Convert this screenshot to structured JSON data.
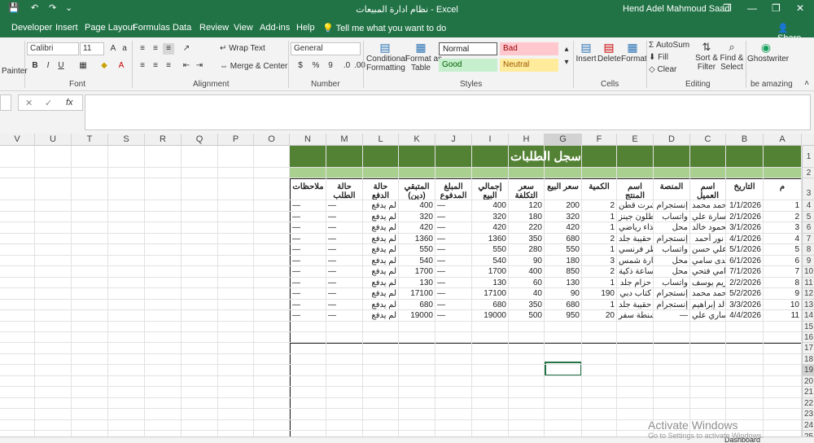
{
  "titlebar": {
    "title": "نظام ادارة المبيعات  -  Excel",
    "user": "Hend  Adel Mahmoud Saad",
    "undo_icon": "↶",
    "redo_icon": "↷",
    "save_icon": "💾",
    "qa_more": "⌄",
    "restore": "❐",
    "minimize": "—",
    "maximize": "❐",
    "close": "✕"
  },
  "ribbon_tabs": [
    "Developer",
    "Insert",
    "Page Layout",
    "Formulas",
    "Data",
    "Review",
    "View",
    "Add-ins",
    "Help"
  ],
  "tellme": "Tell me what you want to do",
  "share": "Share",
  "ribbon": {
    "painter": "Painter",
    "font_name": "Calibri",
    "font_size": "11",
    "font_group": "Font",
    "alignment_group": "Alignment",
    "wrap_text": "Wrap Text",
    "merge_center": "Merge & Center",
    "number_format": "General",
    "number_group": "Number",
    "currency": "$",
    "percent": "%",
    "comma": "9",
    "conditional_formatting": [
      "Conditional",
      "Formatting"
    ],
    "format_as_table": [
      "Format as",
      "Table"
    ],
    "styles_group": "Styles",
    "style_normal": "Normal",
    "style_bad": "Bad",
    "style_good": "Good",
    "style_neutral": "Neutral",
    "insert": "Insert",
    "delete": "Delete",
    "format": "Format",
    "cells_group": "Cells",
    "autosum": "AutoSum",
    "fill": "Fill",
    "clear": "Clear",
    "sort_filter": [
      "Sort &",
      "Filter"
    ],
    "find_select": [
      "Find &",
      "Select"
    ],
    "editing_group": "Editing",
    "ghostwriter": "Ghostwriter",
    "be_amazing": "be amazing"
  },
  "formula_bar": {
    "cancel": "✕",
    "enter": "✓",
    "fx": "fx",
    "value": ""
  },
  "columns": [
    "V",
    "U",
    "T",
    "S",
    "R",
    "Q",
    "P",
    "O",
    "N",
    "M",
    "L",
    "K",
    "J",
    "I",
    "H",
    "G",
    "F",
    "E",
    "D",
    "C",
    "B",
    "A"
  ],
  "rows": [
    "1",
    "2",
    "3",
    "4",
    "5",
    "6",
    "7",
    "8",
    "9",
    "10",
    "11",
    "12",
    "13",
    "14",
    "15",
    "16",
    "17",
    "18",
    "19",
    "20",
    "21",
    "22",
    "23",
    "24",
    "25"
  ],
  "sheet": {
    "banner_title": "سجل الطلبات",
    "headers": [
      "م",
      "التاريخ",
      "اسم العميل",
      "المنصة",
      "اسم المنتج",
      "الكمية",
      "سعر البيع",
      "سعر التكلفة",
      "إجمالي البيع",
      "المبلغ\nالمدفوع",
      "المتبقي\n(دين)",
      "حالة الدفع",
      "حالة الطلب",
      "ملاحظات"
    ],
    "rows": [
      [
        "1",
        "1/1/2026",
        "أحمد محمد",
        "إنستجرام",
        "تيشرت قطن",
        "2",
        "200",
        "120",
        "400",
        "—",
        "400",
        "لم يدفع",
        "—",
        "—"
      ],
      [
        "2",
        "2/1/2026",
        "سارة علي",
        "واتساب",
        "بنطلون جينز",
        "1",
        "320",
        "180",
        "320",
        "—",
        "320",
        "لم يدفع",
        "—",
        "—"
      ],
      [
        "3",
        "3/1/2026",
        "محمود خالد",
        "محل",
        "حذاء رياضي",
        "1",
        "420",
        "220",
        "420",
        "—",
        "420",
        "لم يدفع",
        "—",
        "—"
      ],
      [
        "4",
        "4/1/2026",
        "نور أحمد",
        "إنستجرام",
        "حقيبة جلد",
        "2",
        "680",
        "350",
        "1360",
        "—",
        "1360",
        "لم يدفع",
        "—",
        "—"
      ],
      [
        "5",
        "5/1/2026",
        "علي حسن",
        "واتساب",
        "عطر فرنسي",
        "1",
        "550",
        "280",
        "550",
        "—",
        "550",
        "لم يدفع",
        "—",
        "—"
      ],
      [
        "6",
        "6/1/2026",
        "هدى سامي",
        "محل",
        "نظارة شمس",
        "3",
        "180",
        "90",
        "540",
        "—",
        "540",
        "لم يدفع",
        "—",
        "—"
      ],
      [
        "7",
        "7/1/2026",
        "رامي فتحي",
        "محل",
        "ساعة ذكية",
        "2",
        "850",
        "400",
        "1700",
        "—",
        "1700",
        "لم يدفع",
        "—",
        "—"
      ],
      [
        "8",
        "2/2/2026",
        "ريم يوسف",
        "واتساب",
        "حزام جلد",
        "1",
        "130",
        "60",
        "130",
        "—",
        "130",
        "لم يدفع",
        "—",
        "—"
      ],
      [
        "9",
        "5/2/2026",
        "أحمد محمد",
        "إنستجرام",
        "كتاب دبي",
        "190",
        "90",
        "40",
        "17100",
        "—",
        "17100",
        "لم يدفع",
        "—",
        "—"
      ],
      [
        "10",
        "3/3/2026",
        "خالد إبراهيم",
        "إنستجرام",
        "حقيبة جلد",
        "1",
        "680",
        "350",
        "680",
        "—",
        "680",
        "لم يدفع",
        "—",
        "—"
      ],
      [
        "11",
        "4/4/2026",
        "ساري علي",
        "—",
        "شنطة سفر",
        "20",
        "950",
        "500",
        "19000",
        "—",
        "19000",
        "لم يدفع",
        "—",
        "—"
      ]
    ]
  },
  "sheet_tabs_partial": "Dashboard",
  "watermark": {
    "line1": "Activate Windows",
    "line2": "Go to Settings to activate Windows."
  }
}
